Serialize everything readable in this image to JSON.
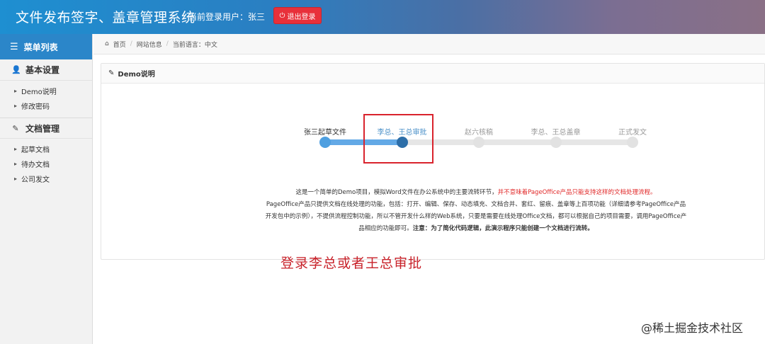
{
  "header": {
    "title": "文件发布签字、盖章管理系统",
    "current_user": "当前登录用户：张三",
    "logout_label": "退出登录"
  },
  "sidebar": {
    "menu_title": "菜单列表",
    "groups": [
      {
        "title": "基本设置",
        "items": [
          "Demo说明",
          "修改密码"
        ]
      },
      {
        "title": "文档管理",
        "items": [
          "起草文档",
          "待办文档",
          "公司发文"
        ]
      }
    ]
  },
  "breadcrumb": [
    "首页",
    "网站信息",
    "当前语言：中文"
  ],
  "panel": {
    "title": "Demo说明",
    "steps": [
      {
        "label": "张三起草文件",
        "status": "done"
      },
      {
        "label": "李总、王总审批",
        "status": "current"
      },
      {
        "label": "赵六核稿",
        "status": "todo"
      },
      {
        "label": "李总、王总盖章",
        "status": "todo"
      },
      {
        "label": "正式发文",
        "status": "todo"
      }
    ],
    "progress_fraction": 0.25,
    "description": {
      "part1": "这是一个简单的Demo项目，模拟Word文件在办公系统中的主要流转环节，",
      "part1_red": "并不意味着PageOffice产品只能支持这样的文档处理流程。",
      "part2": "PageOffice产品只提供文档在线处理的功能，包括：打开、编辑、保存、动态填充、文档合并、套红、留痕、盖章等上百项功能（详细请参考PageOffice产品开发包中的示例），不提供流程控制功能，所以不管开发什么样的Web系统，只要是需要在线处理Office文档，都可以根据自己的项目需要，调用PageOffice产品相应的功能即可。",
      "part2_bold": "注意：为了简化代码逻辑，此演示程序只能创建一个文档进行流转。"
    }
  },
  "annotation": "登录李总或者王总审批",
  "watermark": "@稀土掘金技术社区",
  "colors": {
    "accent": "#2b86c9",
    "logout": "#e8303a",
    "progress": "#63a9e6",
    "highlight": "#d9232d"
  }
}
